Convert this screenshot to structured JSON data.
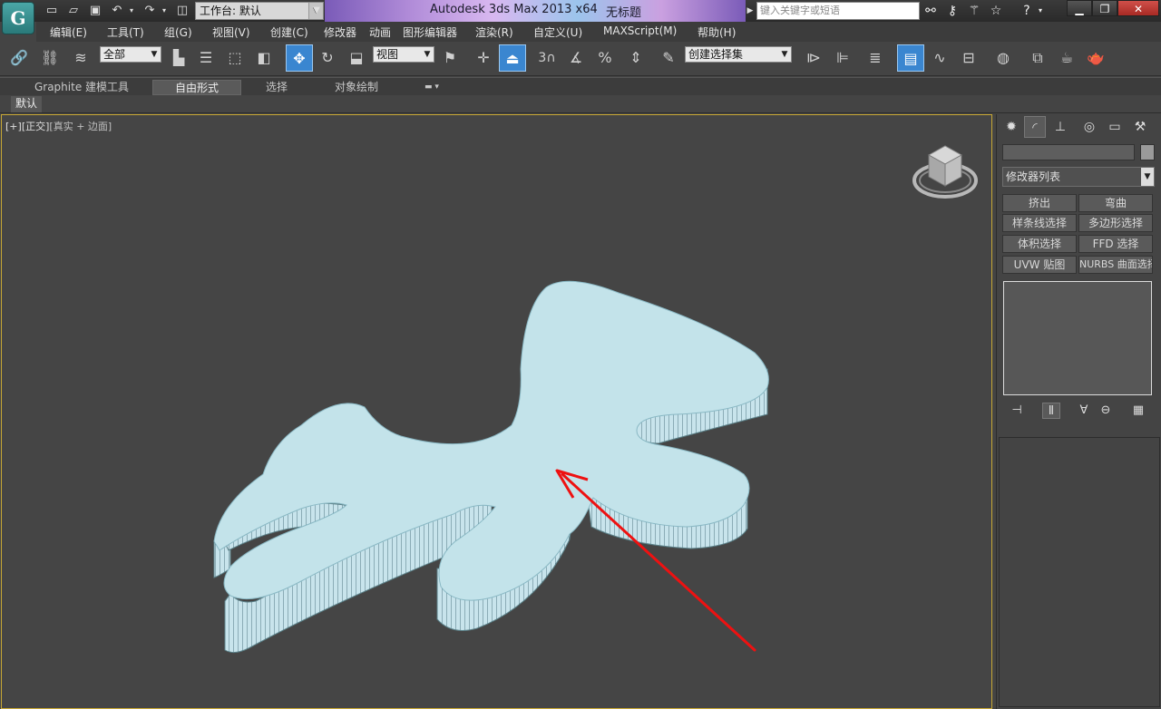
{
  "titlebar": {
    "workspace_label": "工作台: 默认",
    "app_title": "Autodesk 3ds Max  2013 x64",
    "doc_title": "无标题",
    "search_placeholder": "键入关键字或短语",
    "logo_glyph": "G"
  },
  "menu": {
    "items": [
      "编辑(E)",
      "工具(T)",
      "组(G)",
      "视图(V)",
      "创建(C)",
      "修改器",
      "动画",
      "图形编辑器",
      "渲染(R)",
      "自定义(U)",
      "MAXScript(M)",
      "帮助(H)"
    ]
  },
  "toolbar": {
    "selection_filter": "全部",
    "ref_coord": "视图",
    "named_selection": "创建选择集",
    "snap_3d_label": "3"
  },
  "ribbon": {
    "tabs": [
      "Graphite 建模工具",
      "自由形式",
      "选择",
      "对象绘制"
    ],
    "active_tab": 1,
    "sub_tab": "默认"
  },
  "viewport": {
    "label_plus": "[+]",
    "label_view": "[正交]",
    "label_shading": "[真实 + 边面]",
    "object_color": "#c3e3ea",
    "edge_color": "#4a6e78",
    "arrow_color": "#ee1111"
  },
  "command_panel": {
    "modifier_list": "修改器列表",
    "buttons": [
      "挤出",
      "弯曲",
      "样条线选择",
      "多边形选择",
      "体积选择",
      "FFD 选择",
      "UVW 贴图",
      "NURBS 曲面选择"
    ]
  }
}
